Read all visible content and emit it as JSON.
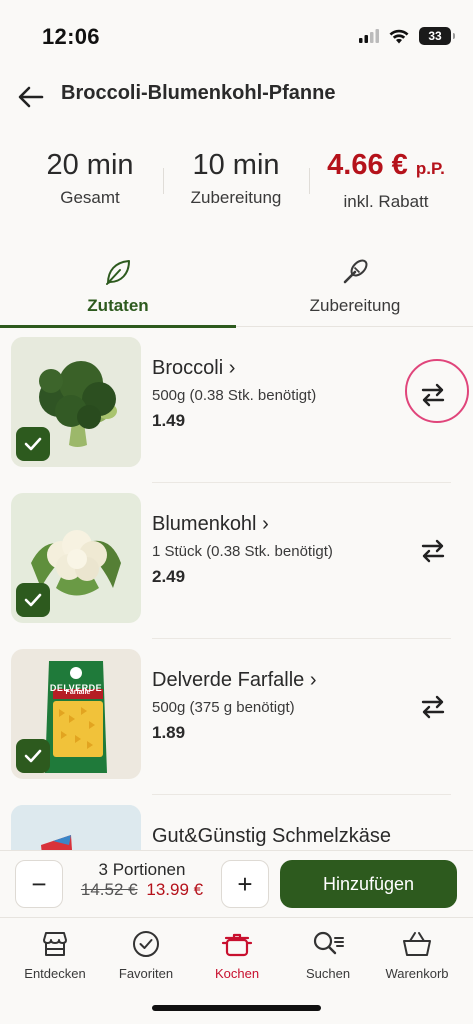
{
  "status_bar": {
    "time": "12:06",
    "battery": "33"
  },
  "header": {
    "title": "Broccoli-Blumenkohl-Pfanne"
  },
  "stats": {
    "total_value": "20 min",
    "total_label": "Gesamt",
    "prep_value": "10 min",
    "prep_label": "Zubereitung",
    "price_value": "4.66 €",
    "price_suffix": "p.P.",
    "price_label": "inkl. Rabatt"
  },
  "tabs": [
    {
      "label": "Zutaten",
      "icon": "leaf-icon",
      "active": true
    },
    {
      "label": "Zubereitung",
      "icon": "whisk-icon",
      "active": false
    }
  ],
  "ingredients": [
    {
      "name": "Broccoli",
      "amount": "500g (0.38 Stk. benötigt)",
      "price": "1.49",
      "checked": true
    },
    {
      "name": "Blumenkohl",
      "amount": "1 Stück (0.38 Stk. benötigt)",
      "price": "2.49",
      "checked": true
    },
    {
      "name": "Delverde Farfalle",
      "amount": "500g (375 g benötigt)",
      "price": "1.89",
      "checked": true,
      "brand_text": "DELVERDE",
      "product_text": "Farfalle"
    },
    {
      "name": "Gut&Günstig Schmelzkäse"
    }
  ],
  "bottom_action": {
    "minus": "−",
    "plus": "+",
    "portions": "3 Portionen",
    "old_price": "14.52 €",
    "new_price": "13.99 €",
    "add_label": "Hinzufügen"
  },
  "nav": [
    {
      "label": "Entdecken",
      "icon": "store-icon"
    },
    {
      "label": "Favoriten",
      "icon": "check-circle-icon"
    },
    {
      "label": "Kochen",
      "icon": "pot-icon",
      "active": true
    },
    {
      "label": "Suchen",
      "icon": "search-list-icon"
    },
    {
      "label": "Warenkorb",
      "icon": "basket-icon"
    }
  ],
  "colors": {
    "accent_green": "#2d5a1e",
    "price_red": "#b5121b",
    "nav_active": "#c8102e",
    "highlight_pink": "#e0457b"
  }
}
